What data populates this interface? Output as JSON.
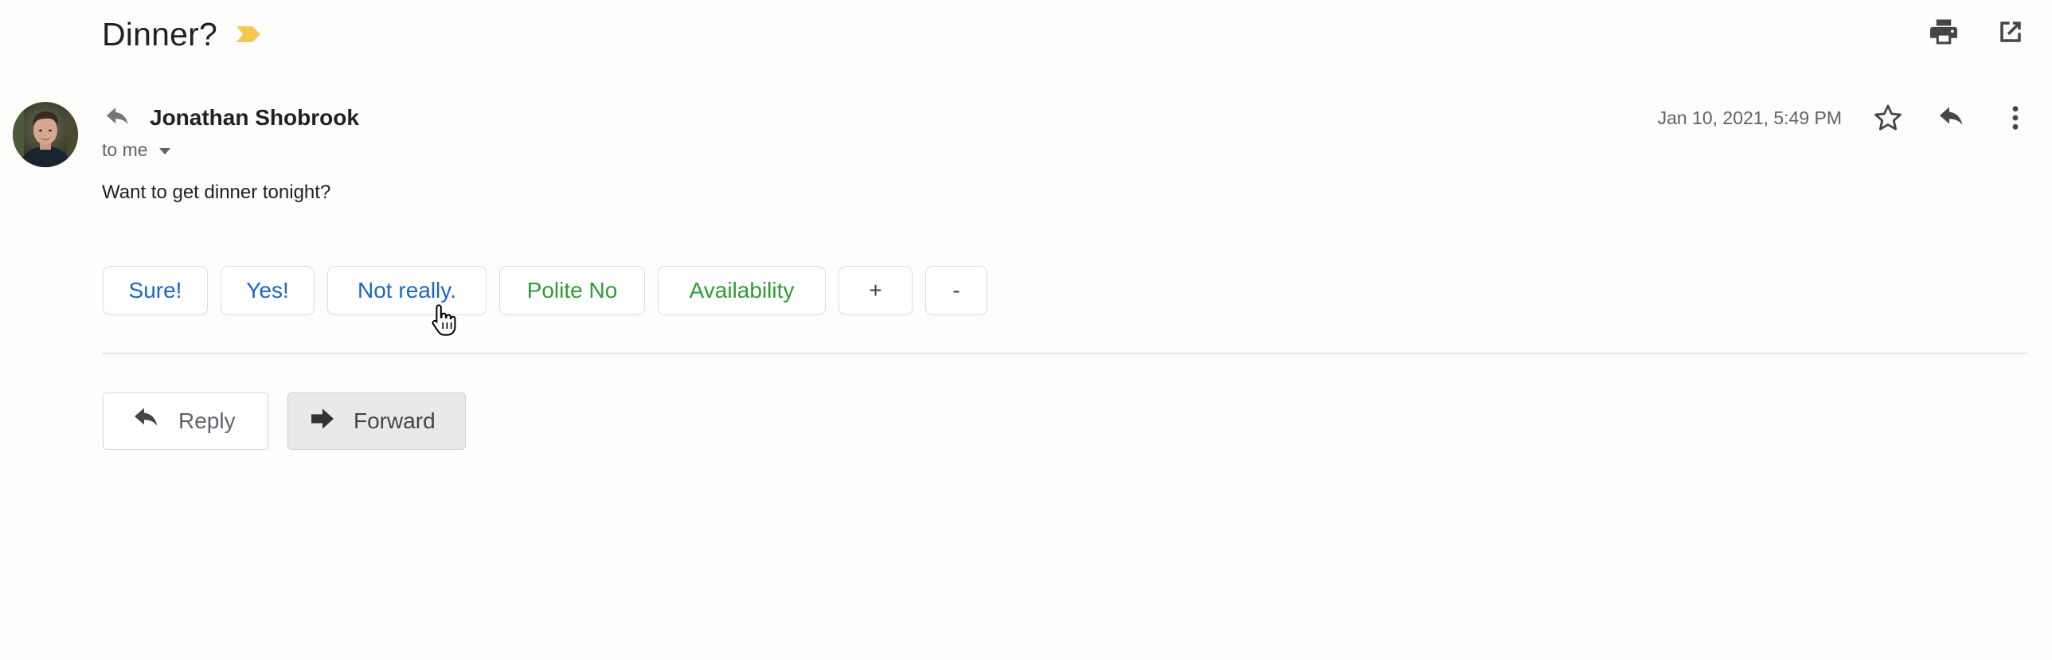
{
  "subject": {
    "title": "Dinner?",
    "marker_icon": "importance-marker-icon",
    "marker_color": "#f4c74f"
  },
  "toolbar": {
    "print_icon": "print-icon",
    "open_new_window_icon": "open-in-new-window-icon"
  },
  "message": {
    "sender_name": "Jonathan Shobrook",
    "recipient_label": "to me",
    "date": "Jan 10, 2021, 5:49 PM",
    "body": "Want to get dinner tonight?",
    "star_icon": "star-outline-icon",
    "reply_icon": "reply-icon",
    "more_icon": "more-vert-icon"
  },
  "smart_replies": [
    {
      "label": "Sure!",
      "color": "#1a66c8"
    },
    {
      "label": "Yes!",
      "color": "#1a66c8"
    },
    {
      "label": "Not really.",
      "color": "#1a66c8"
    },
    {
      "label": "Polite No",
      "color": "#2e9b34"
    },
    {
      "label": "Availability",
      "color": "#2e9b34"
    },
    {
      "label": "+",
      "color": "#3c4043"
    },
    {
      "label": "-",
      "color": "#3c4043"
    }
  ],
  "actions": {
    "reply_label": "Reply",
    "forward_label": "Forward"
  }
}
